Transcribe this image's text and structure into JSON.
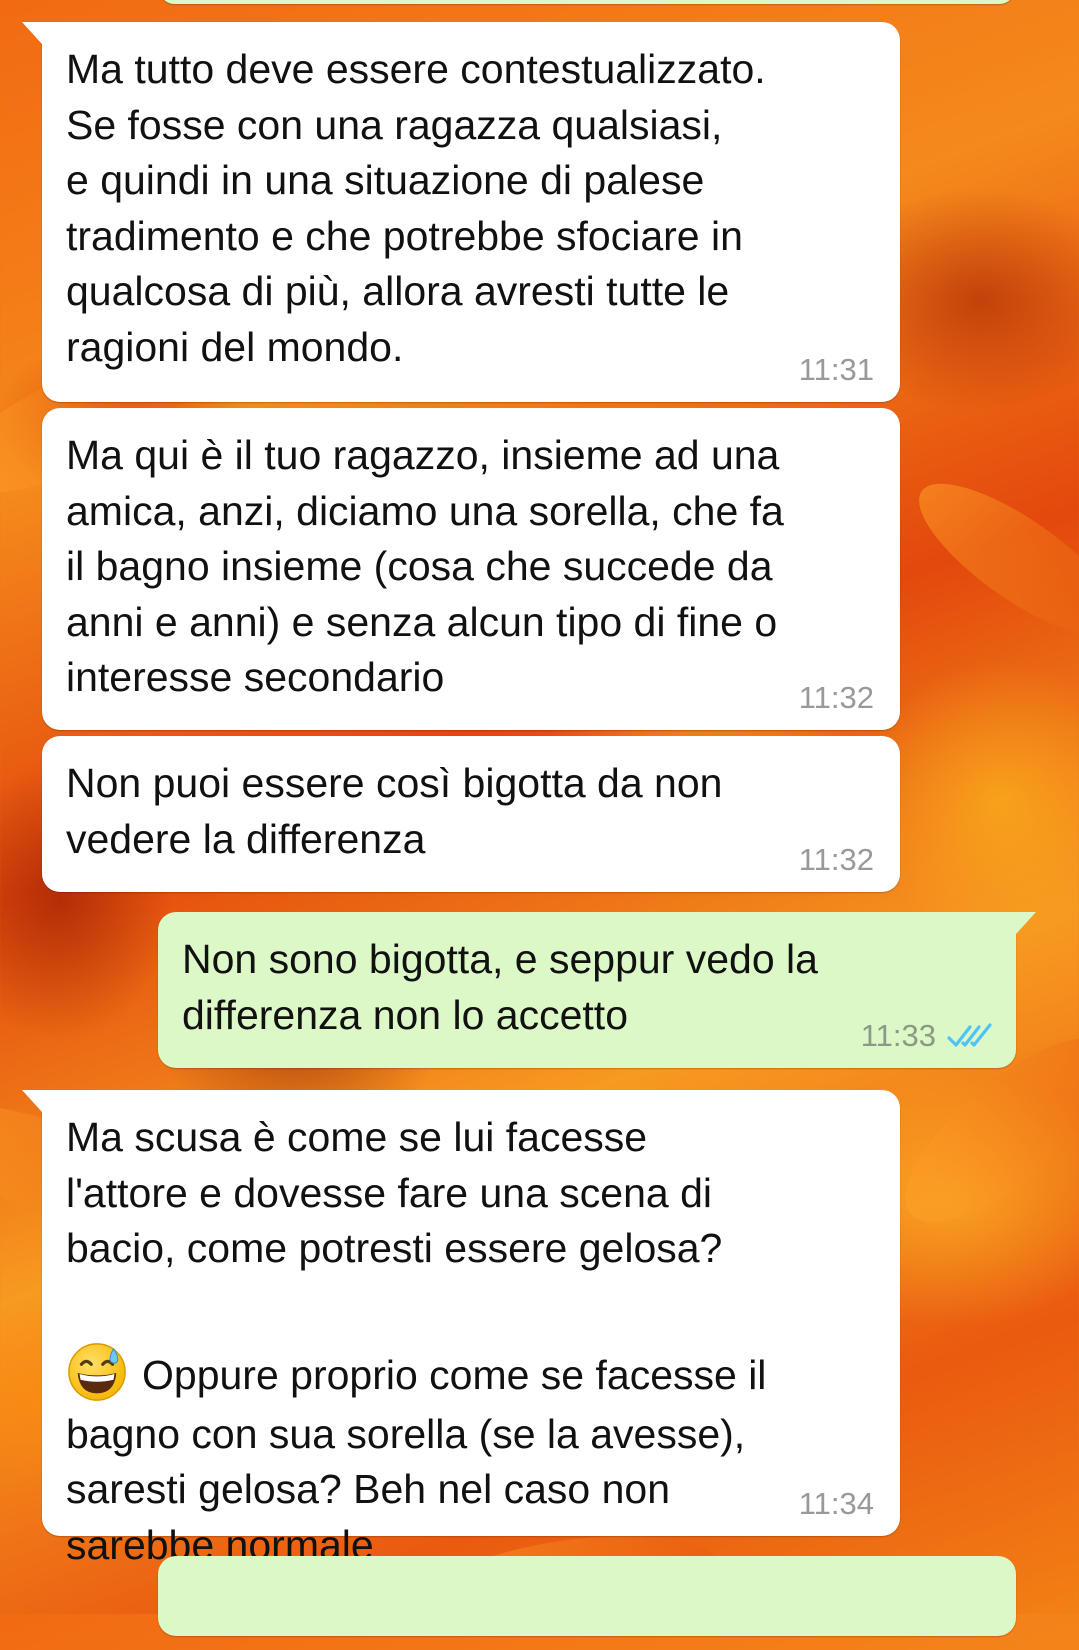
{
  "colors": {
    "incoming_bubble": "#ffffff",
    "outgoing_bubble": "#dcf8c6",
    "timestamp": "#999999",
    "read_ticks": "#4fc3f7"
  },
  "messages": [
    {
      "direction": "incoming",
      "text": "Ma tutto deve essere contestualizzato.\nSe fosse con una ragazza qualsiasi,\ne quindi in una situazione di palese\ntradimento e che potrebbe sfociare in\nqualcosa di più, allora avresti tutte le\nragioni del mondo.",
      "time": "11:31"
    },
    {
      "direction": "incoming",
      "text": "Ma qui è il tuo ragazzo, insieme ad una\namica, anzi, diciamo una sorella, che fa\nil bagno insieme (cosa che succede da\nanni e anni) e senza alcun tipo di fine o\ninteresse secondario",
      "time": "11:32"
    },
    {
      "direction": "incoming",
      "text": "Non puoi essere così bigotta da non\nvedere la differenza",
      "time": "11:32"
    },
    {
      "direction": "outgoing",
      "text": "Non sono bigotta, e seppur vedo la\ndifferenza non lo accetto",
      "time": "11:33",
      "status_icon": "double-check-read-icon"
    },
    {
      "direction": "incoming",
      "text_before_emoji": "Ma scusa è come se lui facesse\nl'attore e dovesse fare una scena di\nbacio, come potresti essere gelosa?",
      "emoji": "grinning-face-with-sweat-emoji",
      "text_after_emoji": "Oppure proprio come se facesse il",
      "text_end": "bagno con sua sorella (se la avesse),\nsaresti gelosa? Beh nel caso non\nsarebbe normale",
      "time": "11:34"
    }
  ]
}
